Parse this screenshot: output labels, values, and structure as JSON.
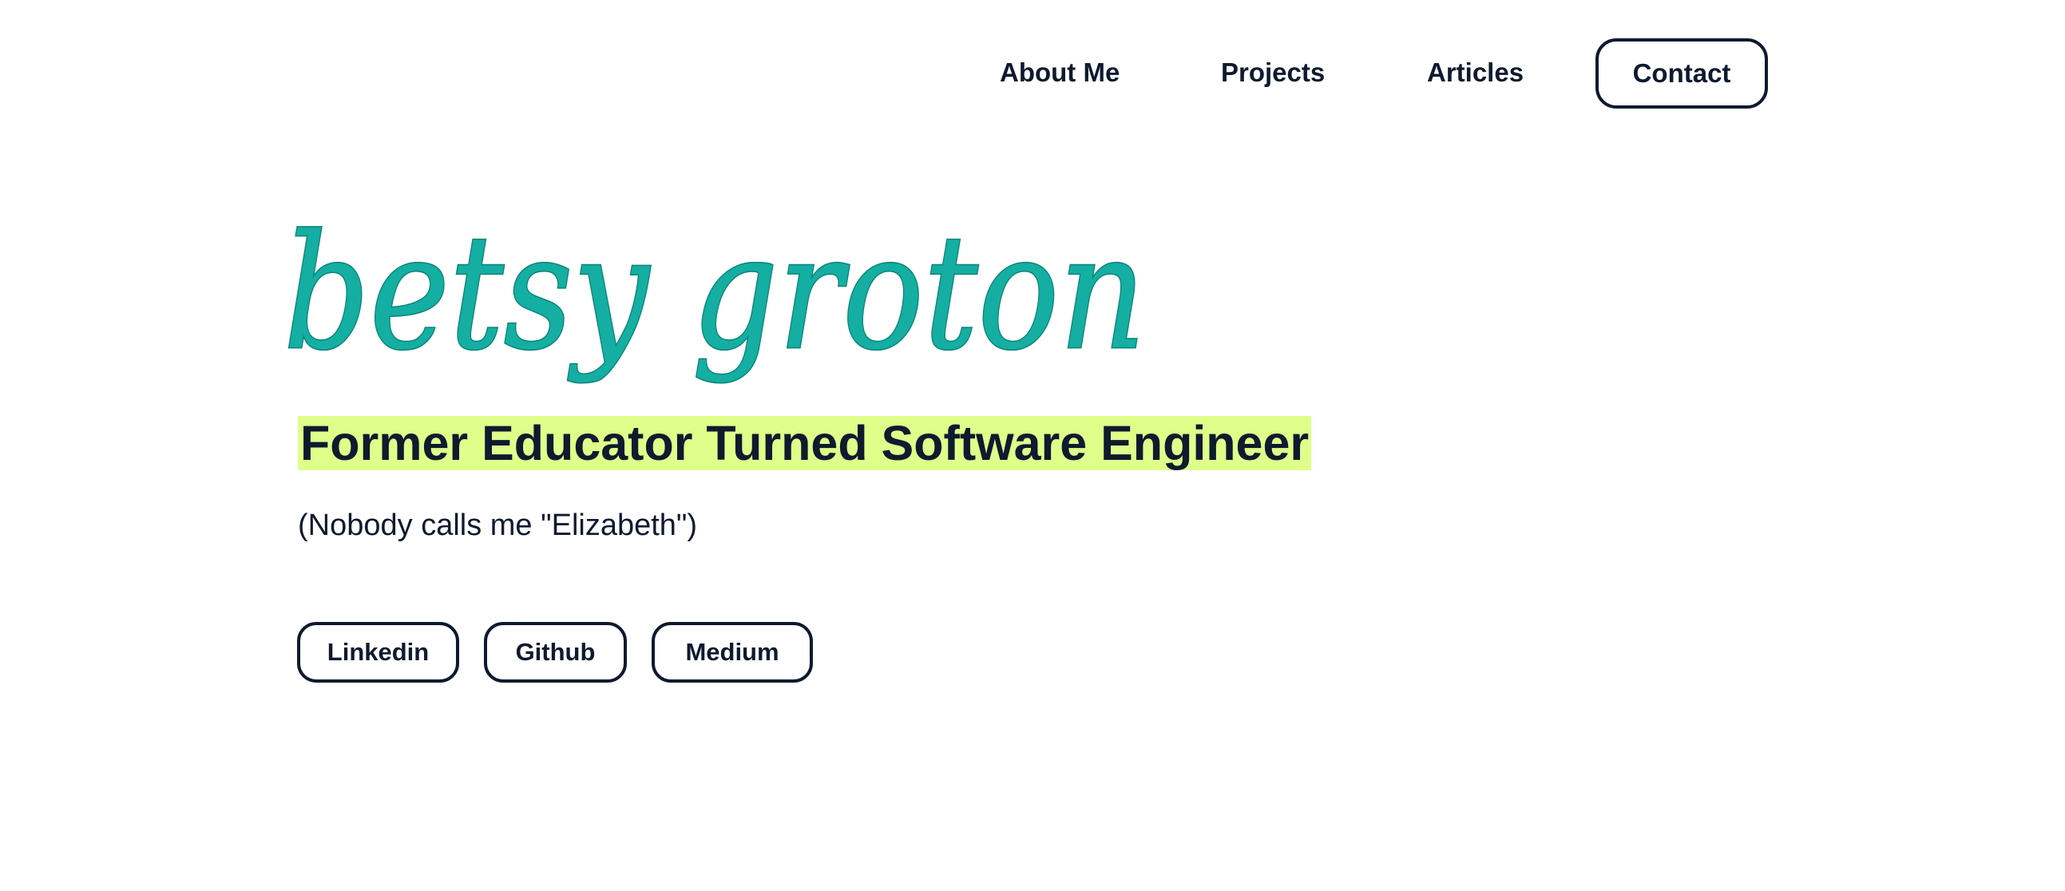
{
  "nav": {
    "items": [
      {
        "label": "About Me"
      },
      {
        "label": "Projects"
      },
      {
        "label": "Articles"
      }
    ],
    "contact_label": "Contact"
  },
  "hero": {
    "logo_text": "betsy groton",
    "headline": "Former Educator Turned Software Engineer",
    "subtitle": "(Nobody calls me \"Elizabeth\")"
  },
  "social": {
    "links": [
      {
        "label": "Linkedin"
      },
      {
        "label": "Github"
      },
      {
        "label": "Medium"
      }
    ]
  },
  "colors": {
    "text": "#0e1a2e",
    "logo": "#14aea2",
    "highlight": "#dfff8a",
    "background": "#ffffff"
  }
}
